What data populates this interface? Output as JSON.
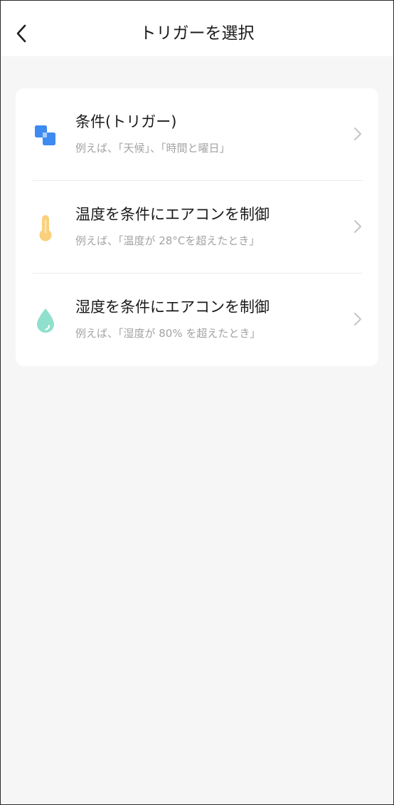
{
  "header": {
    "title": "トリガーを選択",
    "back_icon": "chevron-left-icon"
  },
  "options": [
    {
      "label": "条件(トリガー)",
      "example": "例えば、「天候」、「時間と曜日」",
      "icon": "condition-squares-icon",
      "color": "#3d8bf0"
    },
    {
      "label": "温度を条件にエアコンを制御",
      "example": "例えば、「温度が 28°Cを超えたとき」",
      "icon": "thermometer-icon",
      "color": "#fbd07c"
    },
    {
      "label": "湿度を条件にエアコンを制御",
      "example": "例えば、「湿度が 80% を超えたとき」",
      "icon": "water-drop-icon",
      "color": "#8fe0cc"
    }
  ],
  "colors": {
    "background": "#f6f6f6",
    "card": "#ffffff",
    "subtext": "#a3a3a3",
    "chevron": "#c4c4c4"
  }
}
